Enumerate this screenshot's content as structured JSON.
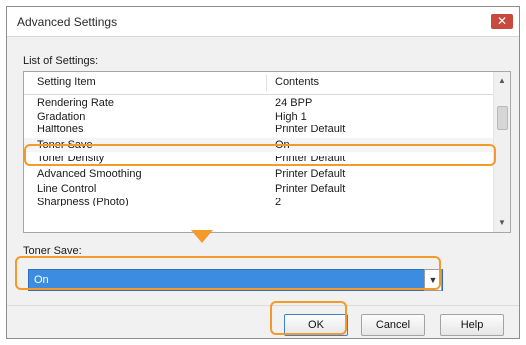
{
  "window": {
    "title": "Advanced Settings",
    "close_icon": "close-icon"
  },
  "list": {
    "label": "List of Settings:",
    "columns": [
      "Setting Item",
      "Contents"
    ],
    "rows": [
      {
        "item": "Rendering Rate",
        "contents": "24 BPP"
      },
      {
        "item": "Gradation",
        "contents": "High 1"
      },
      {
        "item": "Halftones",
        "contents": "Printer Default"
      },
      {
        "item": "Toner Save",
        "contents": "On",
        "selected": true
      },
      {
        "item": "Toner Density",
        "contents": "Printer Default"
      },
      {
        "item": "Advanced Smoothing",
        "contents": "Printer Default"
      },
      {
        "item": "Line Control",
        "contents": "Printer Default"
      },
      {
        "item": "Sharpness (Photo)",
        "contents": "2"
      }
    ]
  },
  "toner_save": {
    "label": "Toner Save:",
    "selected_value": "On"
  },
  "buttons": {
    "ok": "OK",
    "cancel": "Cancel",
    "help": "Help"
  },
  "colors": {
    "highlight": "#f39a2b",
    "selection": "#3c8de1",
    "close_button": "#c84a3f"
  }
}
